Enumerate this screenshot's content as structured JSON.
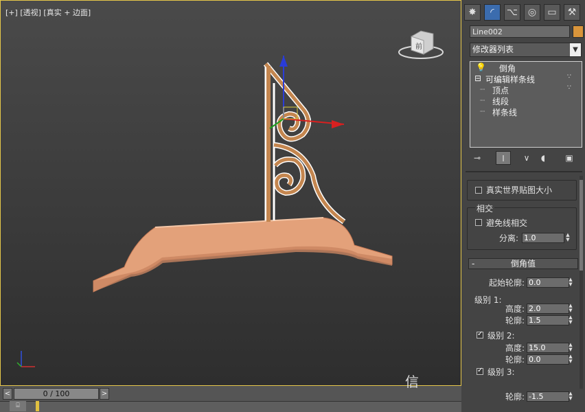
{
  "viewport": {
    "label_plus": "[+]",
    "label_view": "[透视]",
    "label_shading": "[真实 + 边面]",
    "viewcube_text": "前"
  },
  "timeline": {
    "slider": "0 / 100",
    "prev": "<",
    "next": ">"
  },
  "command_panel": {
    "tabs": [
      {
        "icon": "sun-icon",
        "glyph": "✸"
      },
      {
        "icon": "modify-icon",
        "glyph": "◜"
      },
      {
        "icon": "hierarchy-icon",
        "glyph": "⌥"
      },
      {
        "icon": "motion-icon",
        "glyph": "◎"
      },
      {
        "icon": "display-icon",
        "glyph": "▭"
      },
      {
        "icon": "utilities-icon",
        "glyph": "⚒"
      }
    ],
    "object_name": "Line002",
    "object_color": "#d9953b",
    "modifier_list": "修改器列表",
    "stack": {
      "top_modifier": "倒角",
      "base": "可编辑样条线",
      "subs": [
        "顶点",
        "线段",
        "样条线"
      ]
    },
    "stack_buttons": [
      "pin-stack-icon",
      "show-end-result-icon",
      "make-unique-icon",
      "remove-modifier-icon",
      "configure-icon"
    ]
  },
  "params": {
    "real_world_map": "真实世界贴图大小",
    "intersect_group": "相交",
    "avoid_intersect": "避免线相交",
    "separation_label": "分离:",
    "separation_value": "1.0",
    "bevel_rollout": "倒角值",
    "start_outline_label": "起始轮廓:",
    "start_outline_value": "0.0",
    "level1": "级别 1:",
    "level1_height_label": "高度:",
    "level1_height": "2.0",
    "level1_outline_label": "轮廓:",
    "level1_outline": "1.5",
    "level2": "级别 2:",
    "level2_checked": true,
    "level2_height_label": "高度:",
    "level2_height": "15.0",
    "level2_outline_label": "轮廓:",
    "level2_outline": "0.0",
    "level3": "级别 3:",
    "level3_checked": true,
    "level3_outline_label": "轮廓:",
    "level3_outline": "-1.5"
  },
  "watermark": "信"
}
